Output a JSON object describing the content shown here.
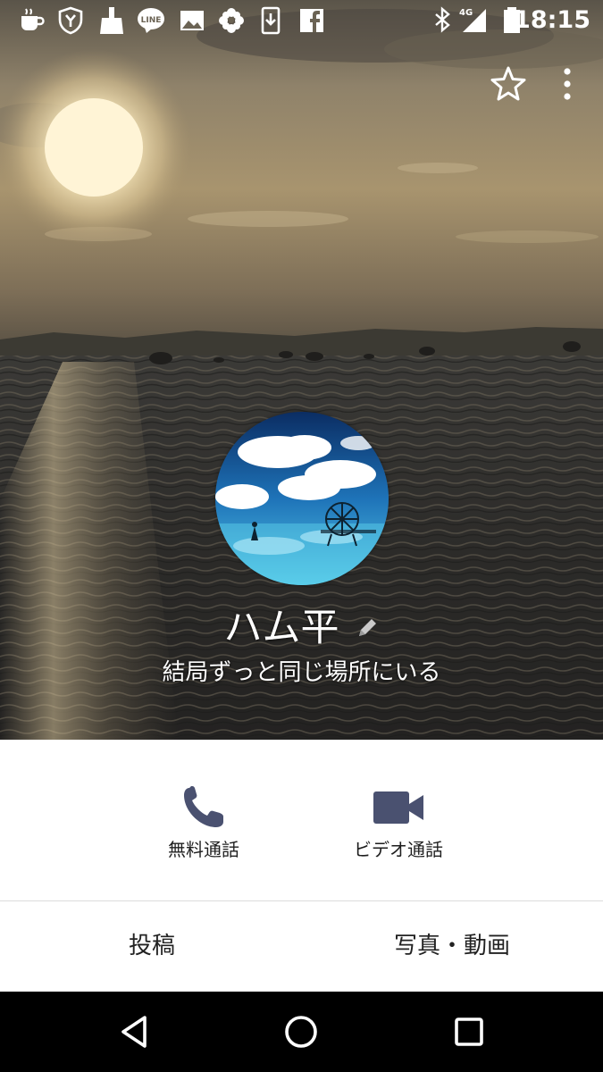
{
  "status_bar": {
    "time": "18:15",
    "network": "4G",
    "icons": [
      "coffee-cup-icon",
      "y-shield-icon",
      "broom-icon",
      "line-app-icon",
      "gallery-icon",
      "pinwheel-icon",
      "download-icon",
      "facebook-icon",
      "bluetooth-icon",
      "signal-icon",
      "battery-icon"
    ]
  },
  "hero_actions": {
    "favorite_icon": "star-outline-icon",
    "menu_icon": "more-vertical-icon"
  },
  "profile": {
    "name": "ハム平",
    "status_message": "結局ずっと同じ場所にいる",
    "edit_icon": "pencil-icon"
  },
  "actions": [
    {
      "label": "無料通話",
      "icon": "phone-icon"
    },
    {
      "label": "ビデオ通話",
      "icon": "video-camera-icon"
    }
  ],
  "tabs": [
    {
      "label": "投稿"
    },
    {
      "label": "写真・動画"
    }
  ],
  "nav_bar": {
    "icons": [
      "back-triangle-icon",
      "home-circle-icon",
      "recents-square-icon"
    ]
  },
  "colors": {
    "icon_accent": "#4a5170",
    "nav_background": "#000000",
    "text_dark": "#1e1e1e"
  }
}
